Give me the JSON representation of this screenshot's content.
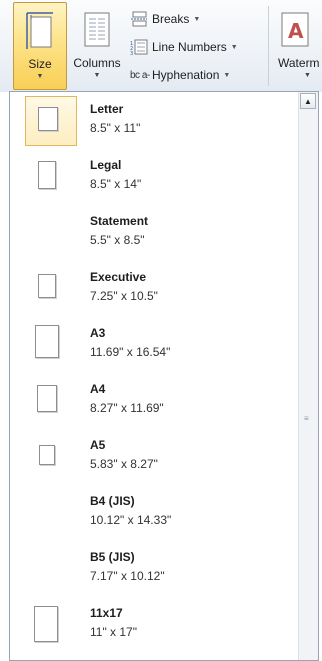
{
  "ribbon": {
    "size_label": "Size",
    "columns_label": "Columns",
    "breaks_label": "Breaks",
    "line_numbers_label": "Line Numbers",
    "hyphenation_label": "Hyphenation",
    "watermark_label": "Waterm",
    "dropdown_glyph": "▼",
    "hyphen_icon_text": "bc a-"
  },
  "gallery": {
    "items": [
      {
        "name": "Letter",
        "dims": "8.5\" x 11\""
      },
      {
        "name": "Legal",
        "dims": "8.5\" x 14\""
      },
      {
        "name": "Statement",
        "dims": "5.5\" x 8.5\""
      },
      {
        "name": "Executive",
        "dims": "7.25\" x 10.5\""
      },
      {
        "name": "A3",
        "dims": "11.69\" x 16.54\""
      },
      {
        "name": "A4",
        "dims": "8.27\" x 11.69\""
      },
      {
        "name": "A5",
        "dims": "5.83\" x 8.27\""
      },
      {
        "name": "B4 (JIS)",
        "dims": "10.12\" x 14.33\""
      },
      {
        "name": "B5 (JIS)",
        "dims": "7.17\" x 10.12\""
      },
      {
        "name": "11x17",
        "dims": "11\" x 17\""
      }
    ]
  },
  "colors": {
    "selected_border": "#e3b55d",
    "selected_fill": "#fdeec0",
    "panel_border": "#9aa5b3"
  }
}
